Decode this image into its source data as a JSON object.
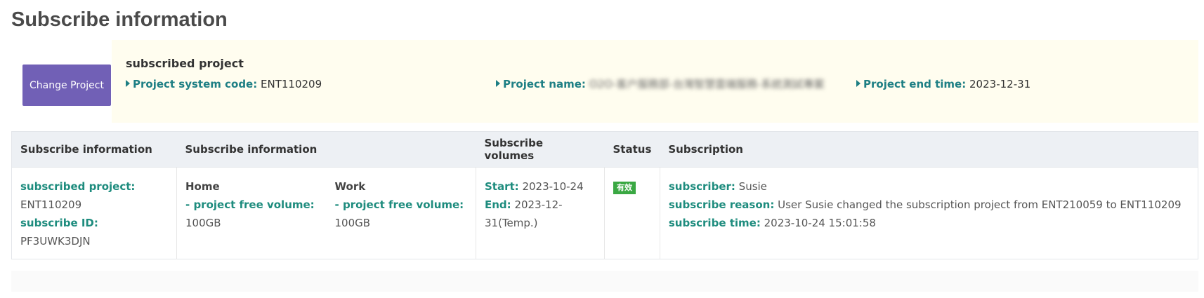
{
  "page": {
    "title": "Subscribe information"
  },
  "project": {
    "change_button": "Change Project",
    "heading": "subscribed project",
    "system_code_label": "Project system code:",
    "system_code_value": "ENT110209",
    "name_label": "Project name:",
    "name_value": "O2O-客户服務部-台灣智慧雲端服務-系統測試專案",
    "end_time_label": "Project end time:",
    "end_time_value": "2023-12-31"
  },
  "table": {
    "headers": [
      "Subscribe information",
      "Subscribe information",
      "Subscribe volumes",
      "Status",
      "Subscription"
    ],
    "row": {
      "subscribed_project_label": "subscribed project:",
      "subscribed_project_value": "ENT110209",
      "subscribe_id_label": "subscribe ID:",
      "subscribe_id_value": "PF3UWK3DJN",
      "home_title": "Home",
      "home_free_label": "- project free volume:",
      "home_free_value": "100GB",
      "work_title": "Work",
      "work_free_label": "- project free volume:",
      "work_free_value": "100GB",
      "start_label": "Start:",
      "start_value": "2023-10-24",
      "end_label": "End:",
      "end_value": "2023-12-31(Temp.)",
      "status": "有效",
      "subscriber_label": "subscriber:",
      "subscriber_value": "Susie",
      "reason_label": "subscribe reason:",
      "reason_value": "User Susie changed the subscription project from ENT210059 to ENT110209",
      "time_label": "subscribe time:",
      "time_value": "2023-10-24 15:01:58"
    }
  },
  "colors": {
    "accent_purple": "#7160b6",
    "label_teal": "#1e7f84",
    "status_green": "#3aa843",
    "panel_bg": "#fffdef"
  }
}
